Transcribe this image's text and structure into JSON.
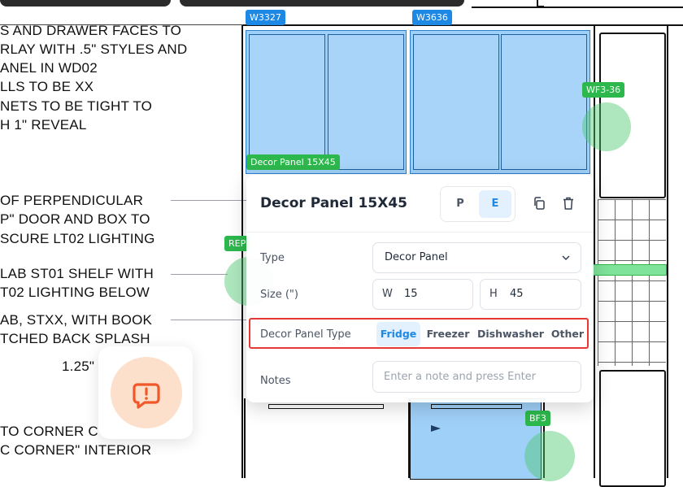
{
  "notes": [
    "S AND DRAWER FACES TO",
    "RLAY WITH .5\" STYLES AND",
    "ANEL IN WD02",
    "LLS TO BE XX",
    "NETS TO BE TIGHT TO",
    "H 1\" REVEAL",
    " OF PERPENDICULAR",
    "P\" DOOR AND BOX TO",
    "SCURE LT02 LIGHTING",
    "LAB ST01 SHELF WITH",
    "T02 LIGHTING BELOW",
    "AB, STXX, WITH BOOK",
    "TCHED BACK SPLASH",
    "1.25\"",
    "TO CORNER C",
    "C CORNER\" INTERIOR"
  ],
  "tags": {
    "w3327": "W3327",
    "w3636": "W3636",
    "wf3": "WF3-36",
    "decor": "Decor Panel 15X45",
    "rep": "REP",
    "bf3": "BF3"
  },
  "panel": {
    "title": "Decor Panel 15X45",
    "view_p": "P",
    "view_e": "E",
    "active_view": "E",
    "type_label": "Type",
    "type_value": "Decor Panel",
    "size_label": "Size (\")",
    "width_prefix": "W",
    "width_value": "15",
    "height_prefix": "H",
    "height_value": "45",
    "decor_type_label": "Decor Panel Type",
    "decor_types": [
      "Fridge",
      "Freezer",
      "Dishwasher",
      "Other"
    ],
    "selected_decor_type": "Fridge",
    "notes_label": "Notes",
    "notes_placeholder": "Enter a note and press Enter"
  },
  "colors": {
    "accent": "#1e88e5",
    "highlight_border": "#e53935",
    "tag_green": "#2db84d",
    "cabinet_fill": "#9fd0f8",
    "feedback_icon": "#f0582a"
  }
}
